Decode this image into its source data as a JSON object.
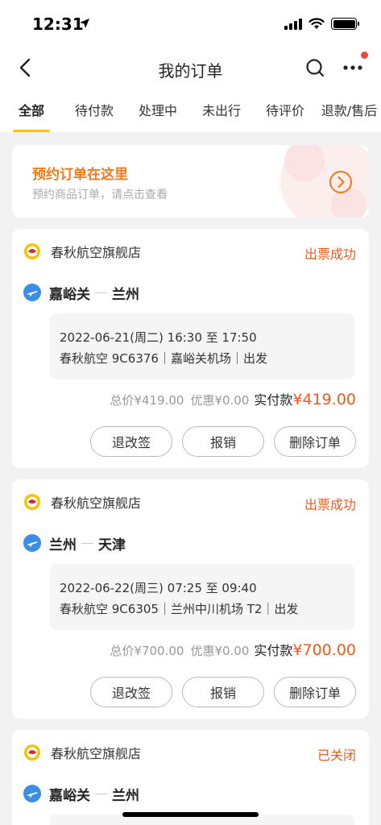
{
  "status_bar": {
    "time": "12:31"
  },
  "nav": {
    "title": "我的订单"
  },
  "tabs": [
    {
      "label": "全部",
      "active": true
    },
    {
      "label": "待付款",
      "active": false
    },
    {
      "label": "处理中",
      "active": false
    },
    {
      "label": "未出行",
      "active": false
    },
    {
      "label": "待评价",
      "active": false
    },
    {
      "label": "退款/售后",
      "active": false
    }
  ],
  "promo": {
    "title": "预约订单在这里",
    "subtitle": "预约商品订单，请点击查看"
  },
  "orders": [
    {
      "shop": "春秋航空旗舰店",
      "status": "出票成功",
      "from": "嘉峪关",
      "to": "兰州",
      "datetime": "2022-06-21(周二) 16:30 至 17:50",
      "flight_info": "春秋航空 9C6376｜嘉峪关机场｜出发",
      "total": "总价¥419.00",
      "discount": "优惠¥0.00",
      "paid_label": "实付款",
      "paid": "¥419.00",
      "buttons": [
        "退改签",
        "报销",
        "删除订单"
      ]
    },
    {
      "shop": "春秋航空旗舰店",
      "status": "出票成功",
      "from": "兰州",
      "to": "天津",
      "datetime": "2022-06-22(周三) 07:25 至 09:40",
      "flight_info": "春秋航空 9C6305｜兰州中川机场 T2｜出发",
      "total": "总价¥700.00",
      "discount": "优惠¥0.00",
      "paid_label": "实付款",
      "paid": "¥700.00",
      "buttons": [
        "退改签",
        "报销",
        "删除订单"
      ]
    },
    {
      "shop": "春秋航空旗舰店",
      "status": "已关闭",
      "from": "嘉峪关",
      "to": "兰州"
    }
  ],
  "colors": {
    "accent": "#ffc300",
    "status_orange": "#f05a1a",
    "promo_orange": "#f07a1a",
    "plane_blue": "#3a8ee6"
  },
  "icons": [
    "location-arrow-icon",
    "signal-icon",
    "wifi-icon",
    "battery-icon",
    "back-chevron-icon",
    "search-icon",
    "more-dots-icon",
    "chevron-right-circle-icon",
    "airline-logo-icon",
    "plane-icon"
  ]
}
